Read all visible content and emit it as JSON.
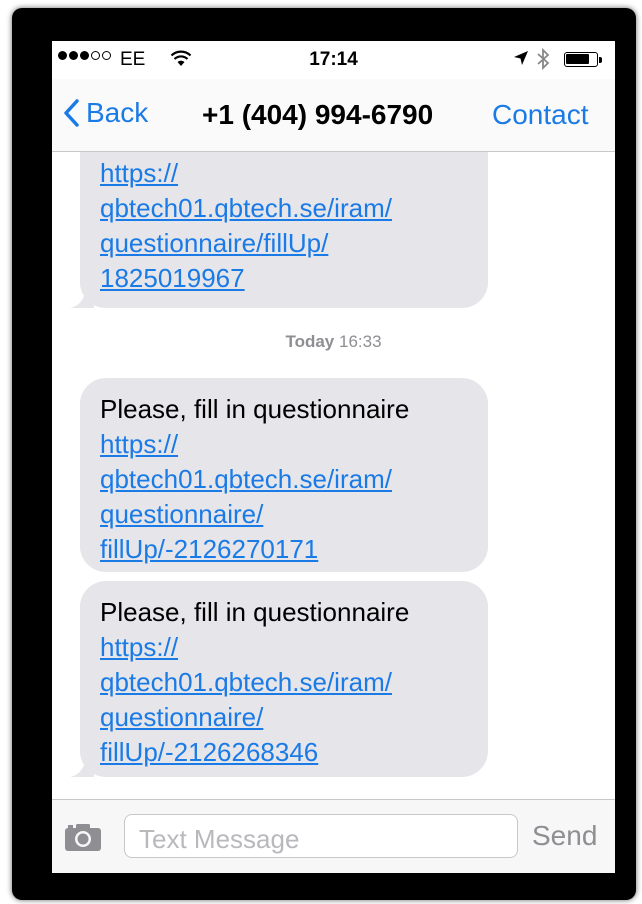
{
  "status_bar": {
    "carrier": "EE",
    "time": "17:14",
    "signal_bars_filled": 3,
    "signal_bars_total": 5,
    "battery_level": 0.75
  },
  "nav": {
    "back_label": "Back",
    "title": "+1 (404) 994-6790",
    "contact_label": "Contact"
  },
  "messages": [
    {
      "text": "",
      "link_lines": [
        "https://",
        "qbtech01.qbtech.se/iram/",
        "questionnaire/fillUp/",
        "1825019967"
      ]
    },
    {
      "text": "Please, fill in questionnaire",
      "link_lines": [
        "https://",
        "qbtech01.qbtech.se/iram/",
        "questionnaire/",
        "fillUp/-2126270171"
      ]
    },
    {
      "text": "Please, fill in questionnaire",
      "link_lines": [
        "https://",
        "qbtech01.qbtech.se/iram/",
        "questionnaire/",
        "fillUp/-2126268346"
      ]
    }
  ],
  "timestamp": {
    "day": "Today",
    "time": "16:33"
  },
  "composer": {
    "placeholder": "Text Message",
    "send_label": "Send"
  },
  "colors": {
    "accent": "#1a7ae6",
    "bubble": "#e5e5ea",
    "timestamp": "#8e8e93"
  }
}
